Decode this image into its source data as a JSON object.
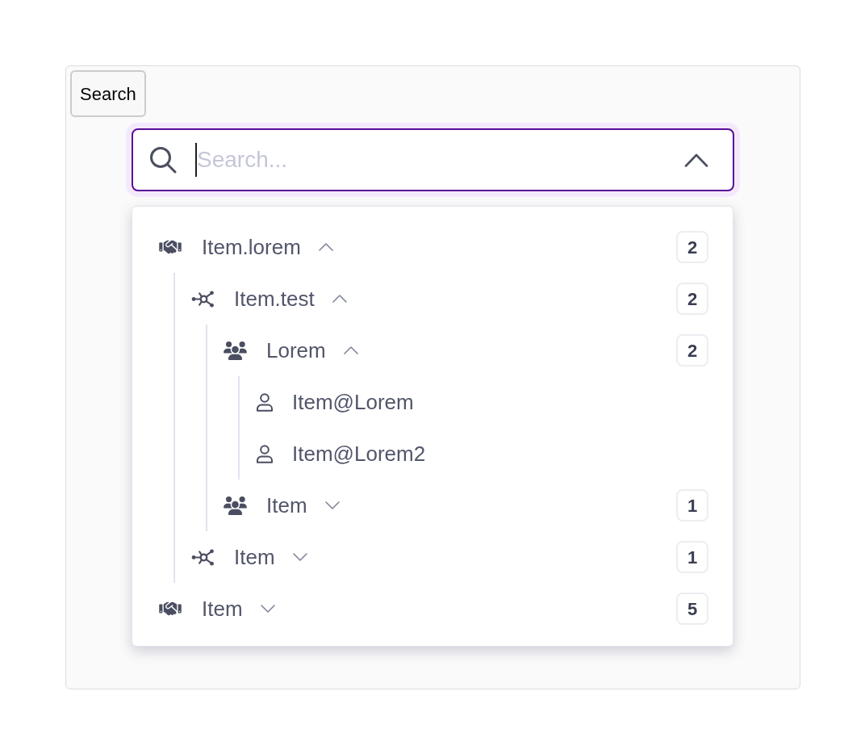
{
  "search_button": {
    "label": "Search"
  },
  "combobox": {
    "placeholder": "Search...",
    "open": true
  },
  "tree": [
    {
      "kind": "organization",
      "label": "Item.lorem",
      "expanded": true,
      "count": "2",
      "children": [
        {
          "kind": "network",
          "label": "Item.test",
          "expanded": true,
          "count": "2",
          "children": [
            {
              "kind": "group",
              "label": "Lorem",
              "expanded": true,
              "count": "2",
              "children": [
                {
                  "kind": "user",
                  "label": "Item@Lorem"
                },
                {
                  "kind": "user",
                  "label": "Item@Lorem2"
                }
              ]
            },
            {
              "kind": "group",
              "label": "Item",
              "expanded": false,
              "count": "1"
            }
          ]
        },
        {
          "kind": "network",
          "label": "Item",
          "expanded": false,
          "count": "1"
        }
      ]
    },
    {
      "kind": "organization",
      "label": "Item",
      "expanded": false,
      "count": "5"
    }
  ]
}
